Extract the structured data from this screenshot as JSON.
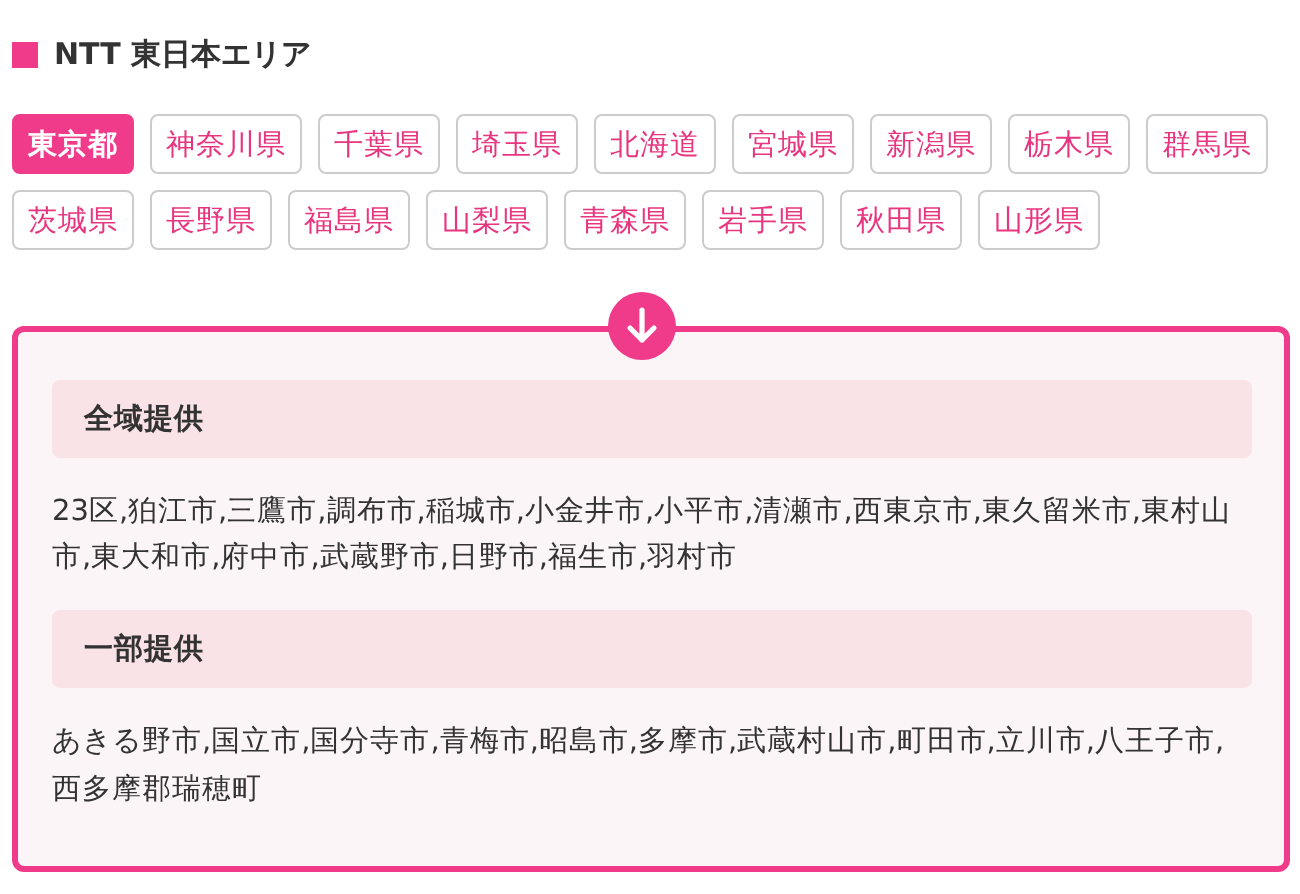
{
  "heading": "NTT 東日本エリア",
  "prefectures": [
    {
      "label": "東京都",
      "selected": true
    },
    {
      "label": "神奈川県",
      "selected": false
    },
    {
      "label": "千葉県",
      "selected": false
    },
    {
      "label": "埼玉県",
      "selected": false
    },
    {
      "label": "北海道",
      "selected": false
    },
    {
      "label": "宮城県",
      "selected": false
    },
    {
      "label": "新潟県",
      "selected": false
    },
    {
      "label": "栃木県",
      "selected": false
    },
    {
      "label": "群馬県",
      "selected": false
    },
    {
      "label": "茨城県",
      "selected": false
    },
    {
      "label": "長野県",
      "selected": false
    },
    {
      "label": "福島県",
      "selected": false
    },
    {
      "label": "山梨県",
      "selected": false
    },
    {
      "label": "青森県",
      "selected": false
    },
    {
      "label": "岩手県",
      "selected": false
    },
    {
      "label": "秋田県",
      "selected": false
    },
    {
      "label": "山形県",
      "selected": false
    }
  ],
  "sections": [
    {
      "title": "全域提供",
      "text": "23区,狛江市,三鷹市,調布市,稲城市,小金井市,小平市,清瀬市,西東京市,東久留米市,東村山市,東大和市,府中市,武蔵野市,日野市,福生市,羽村市"
    },
    {
      "title": "一部提供",
      "text": "あきる野市,国立市,国分寺市,青梅市,昭島市,多摩市,武蔵村山市,町田市,立川市,八王子市,西多摩郡瑞穂町"
    }
  ]
}
